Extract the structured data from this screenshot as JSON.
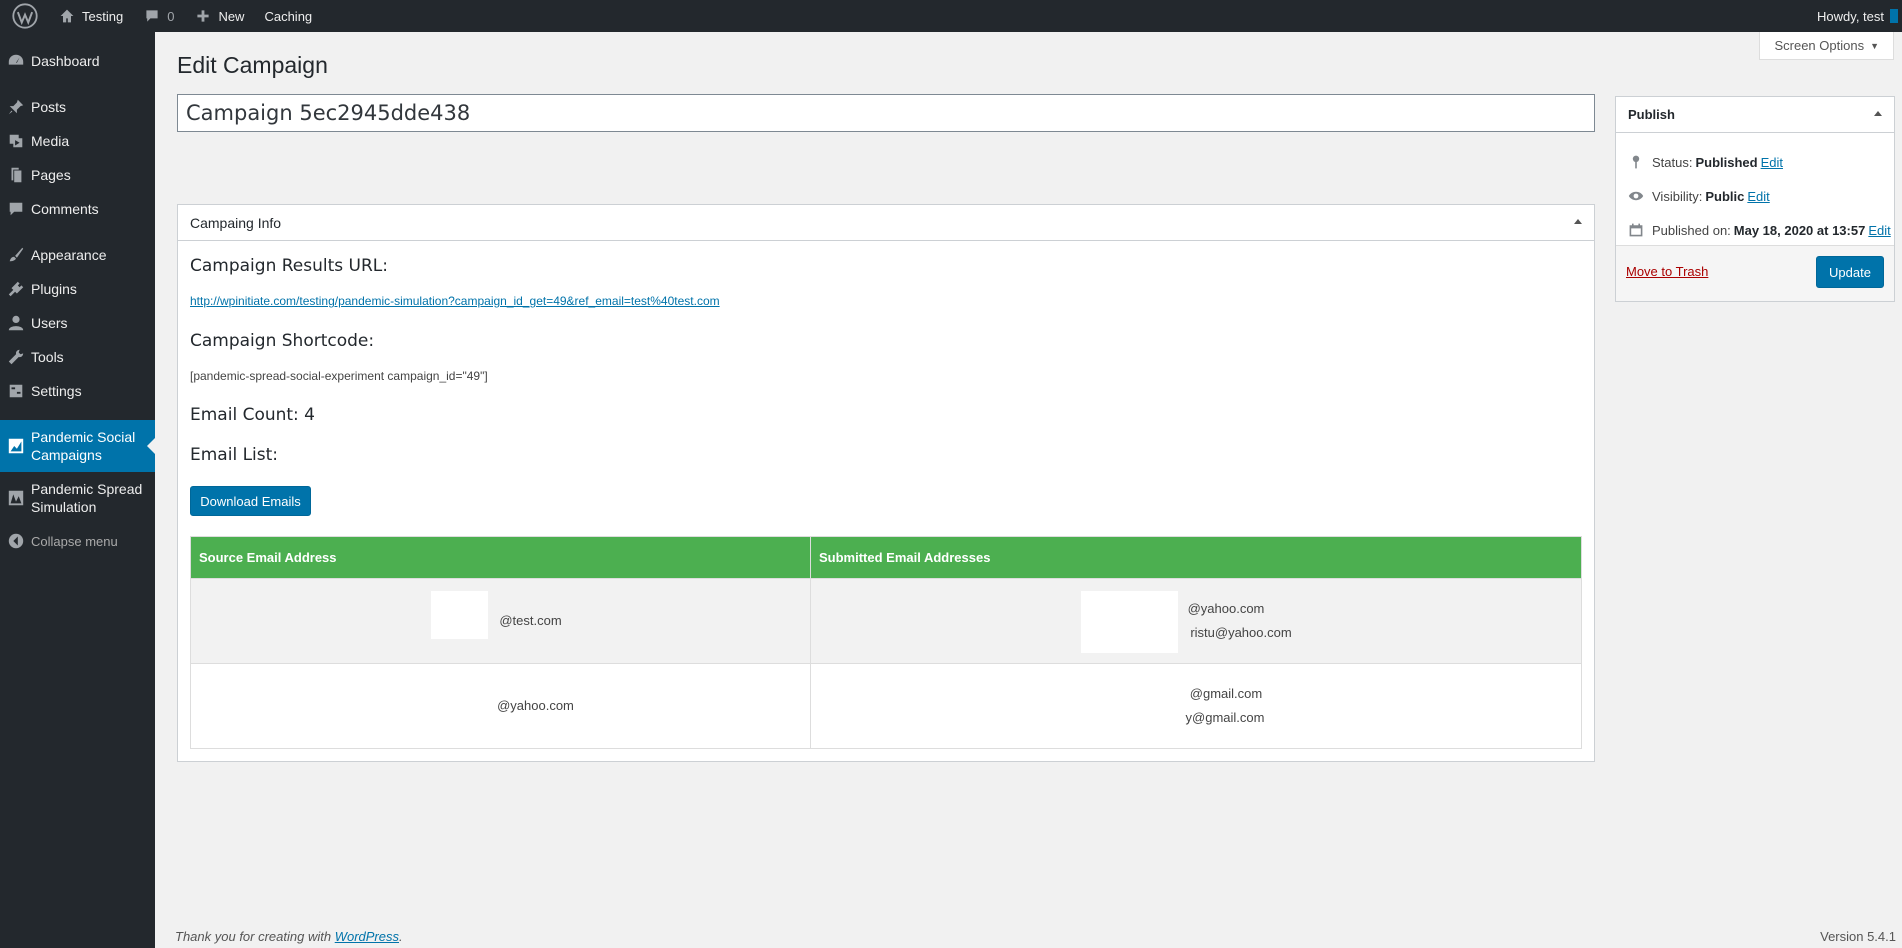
{
  "adminbar": {
    "site_name": "Testing",
    "comments_count": "0",
    "new_label": "New",
    "caching_label": "Caching",
    "howdy": "Howdy, test"
  },
  "sidebar": {
    "items": [
      {
        "label": "Dashboard"
      },
      {
        "label": "Posts"
      },
      {
        "label": "Media"
      },
      {
        "label": "Pages"
      },
      {
        "label": "Comments"
      },
      {
        "label": "Appearance"
      },
      {
        "label": "Plugins"
      },
      {
        "label": "Users"
      },
      {
        "label": "Tools"
      },
      {
        "label": "Settings"
      },
      {
        "label": "Pandemic Social Campaigns"
      },
      {
        "label": "Pandemic Spread Simulation"
      }
    ],
    "collapse_label": "Collapse menu"
  },
  "page": {
    "screen_options": "Screen Options",
    "title": "Edit Campaign",
    "post_title": "Campaign 5ec2945dde438"
  },
  "info_box": {
    "heading": "Campaing Info",
    "results_url_label": "Campaign Results URL:",
    "results_url": "http://wpinitiate.com/testing/pandemic-simulation?campaign_id_get=49&ref_email=test%40test.com",
    "shortcode_label": "Campaign Shortcode:",
    "shortcode": "[pandemic-spread-social-experiment campaign_id=\"49\"]",
    "email_count": "Email Count: 4",
    "email_list_label": "Email List:",
    "download_button": "Download Emails",
    "table": {
      "headers": [
        "Source Email Address",
        "Submitted Email Addresses"
      ],
      "rows": [
        {
          "source": "@test.com",
          "submitted_1": "@yahoo.com",
          "submitted_2": "ristu@yahoo.com"
        },
        {
          "source": "@yahoo.com",
          "submitted_1": "@gmail.com",
          "submitted_2": "y@gmail.com"
        }
      ]
    }
  },
  "publish": {
    "heading": "Publish",
    "status_label": "Status:",
    "status_value": "Published",
    "visibility_label": "Visibility:",
    "visibility_value": "Public",
    "published_label": "Published on:",
    "published_value": "May 18, 2020 at 13:57",
    "edit_link": "Edit",
    "trash_label": "Move to Trash",
    "update_button": "Update"
  },
  "footer": {
    "thanks_prefix": "Thank you for creating with",
    "wp_link": "WordPress",
    "thanks_suffix": ".",
    "version": "Version 5.4.1"
  },
  "colors": {
    "admin_dark": "#23282d",
    "accent": "#0073aa",
    "table_header": "#4caf50",
    "trash": "#aa0000"
  }
}
